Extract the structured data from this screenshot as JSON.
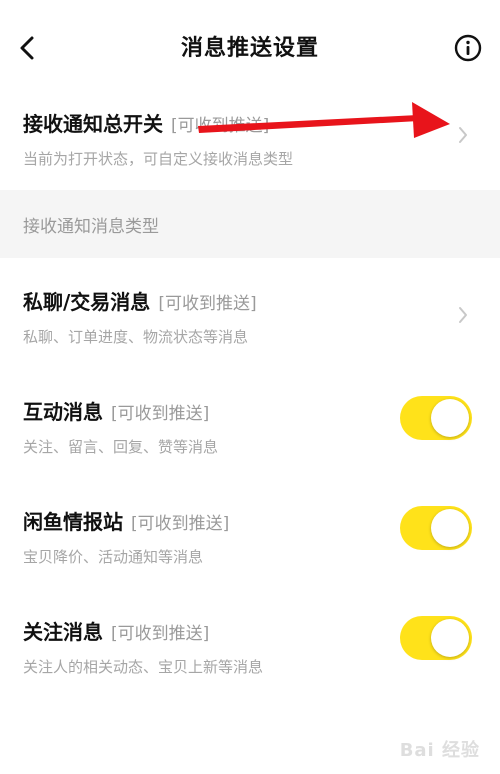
{
  "header": {
    "title": "消息推送设置",
    "back_icon": "chevron-left-icon",
    "info_icon": "info-circle-icon"
  },
  "master": {
    "title": "接收通知总开关",
    "tag": "[可收到推送]",
    "subtitle": "当前为打开状态，可自定义接收消息类型"
  },
  "section": {
    "title": "接收通知消息类型"
  },
  "items": [
    {
      "title": "私聊/交易消息",
      "tag": "[可收到推送]",
      "subtitle": "私聊、订单进度、物流状态等消息",
      "control": "chevron"
    },
    {
      "title": "互动消息",
      "tag": "[可收到推送]",
      "subtitle": "关注、留言、回复、赞等消息",
      "control": "toggle",
      "on": true
    },
    {
      "title": "闲鱼情报站",
      "tag": "[可收到推送]",
      "subtitle": "宝贝降价、活动通知等消息",
      "control": "toggle",
      "on": true
    },
    {
      "title": "关注消息",
      "tag": "[可收到推送]",
      "subtitle": "关注人的相关动态、宝贝上新等消息",
      "control": "toggle",
      "on": true
    }
  ],
  "colors": {
    "toggle_on": "#ffe21a",
    "annotation_arrow": "#e8141b"
  },
  "watermark": {
    "text": "Bai 经验"
  }
}
